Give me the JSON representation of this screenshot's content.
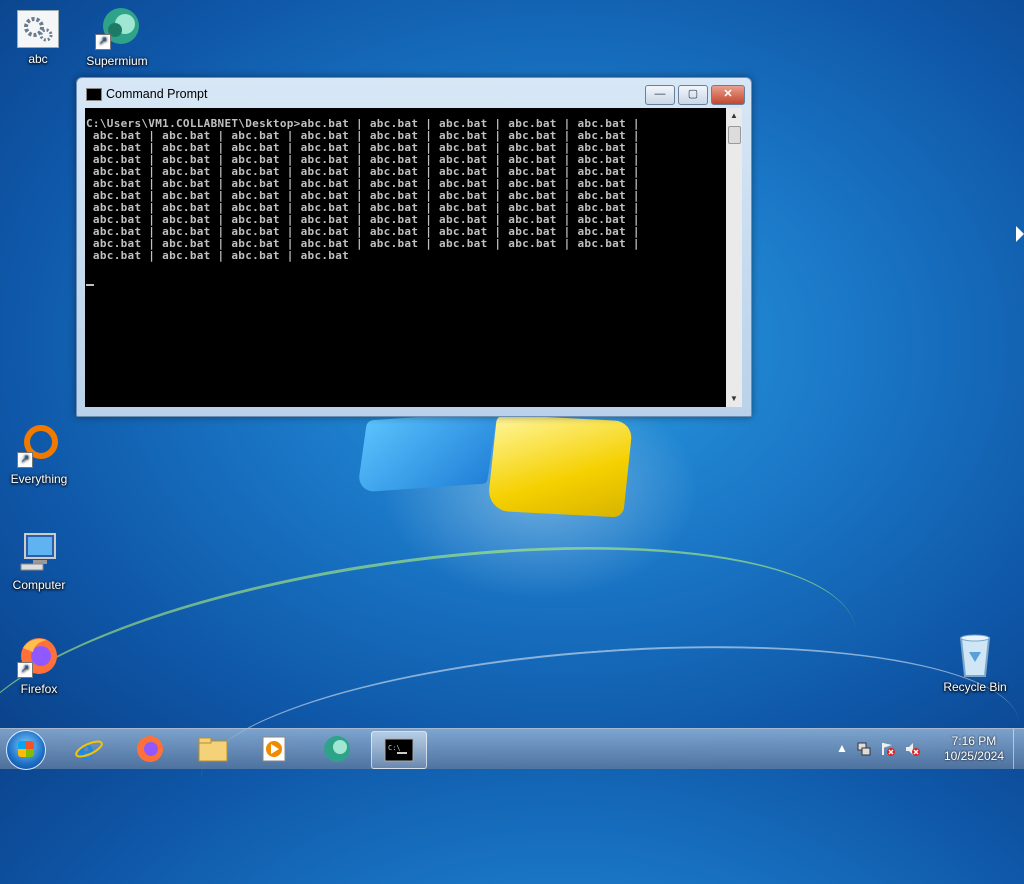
{
  "desktop": {
    "icons": [
      {
        "label": "abc"
      },
      {
        "label": "Supermium"
      },
      {
        "label": "Everything"
      },
      {
        "label": "Computer"
      },
      {
        "label": "Firefox"
      },
      {
        "label": "Recycle Bin"
      }
    ]
  },
  "window": {
    "title": "Command Prompt",
    "minimize": "—",
    "maximize": "▢",
    "close": "✕",
    "console_lines": [
      "C:\\Users\\VM1.COLLABNET\\Desktop>abc.bat | abc.bat | abc.bat | abc.bat | abc.bat |",
      " abc.bat | abc.bat | abc.bat | abc.bat | abc.bat | abc.bat | abc.bat | abc.bat |",
      " abc.bat | abc.bat | abc.bat | abc.bat | abc.bat | abc.bat | abc.bat | abc.bat |",
      " abc.bat | abc.bat | abc.bat | abc.bat | abc.bat | abc.bat | abc.bat | abc.bat |",
      " abc.bat | abc.bat | abc.bat | abc.bat | abc.bat | abc.bat | abc.bat | abc.bat |",
      " abc.bat | abc.bat | abc.bat | abc.bat | abc.bat | abc.bat | abc.bat | abc.bat |",
      " abc.bat | abc.bat | abc.bat | abc.bat | abc.bat | abc.bat | abc.bat | abc.bat |",
      " abc.bat | abc.bat | abc.bat | abc.bat | abc.bat | abc.bat | abc.bat | abc.bat |",
      " abc.bat | abc.bat | abc.bat | abc.bat | abc.bat | abc.bat | abc.bat | abc.bat |",
      " abc.bat | abc.bat | abc.bat | abc.bat | abc.bat | abc.bat | abc.bat | abc.bat |",
      " abc.bat | abc.bat | abc.bat | abc.bat | abc.bat | abc.bat | abc.bat | abc.bat |",
      " abc.bat | abc.bat | abc.bat | abc.bat"
    ]
  },
  "taskbar": {
    "items": [
      "start-button",
      "internet-explorer",
      "firefox",
      "file-explorer",
      "media-player",
      "supermium",
      "command-prompt"
    ],
    "active_item": "command-prompt",
    "tray": {
      "show_hidden": "▲",
      "time": "7:16 PM",
      "date": "10/25/2024"
    }
  },
  "colors": {
    "console_bg": "#000000",
    "console_text": "#c0c0c0",
    "desktop_accent": "#1b79c8"
  }
}
